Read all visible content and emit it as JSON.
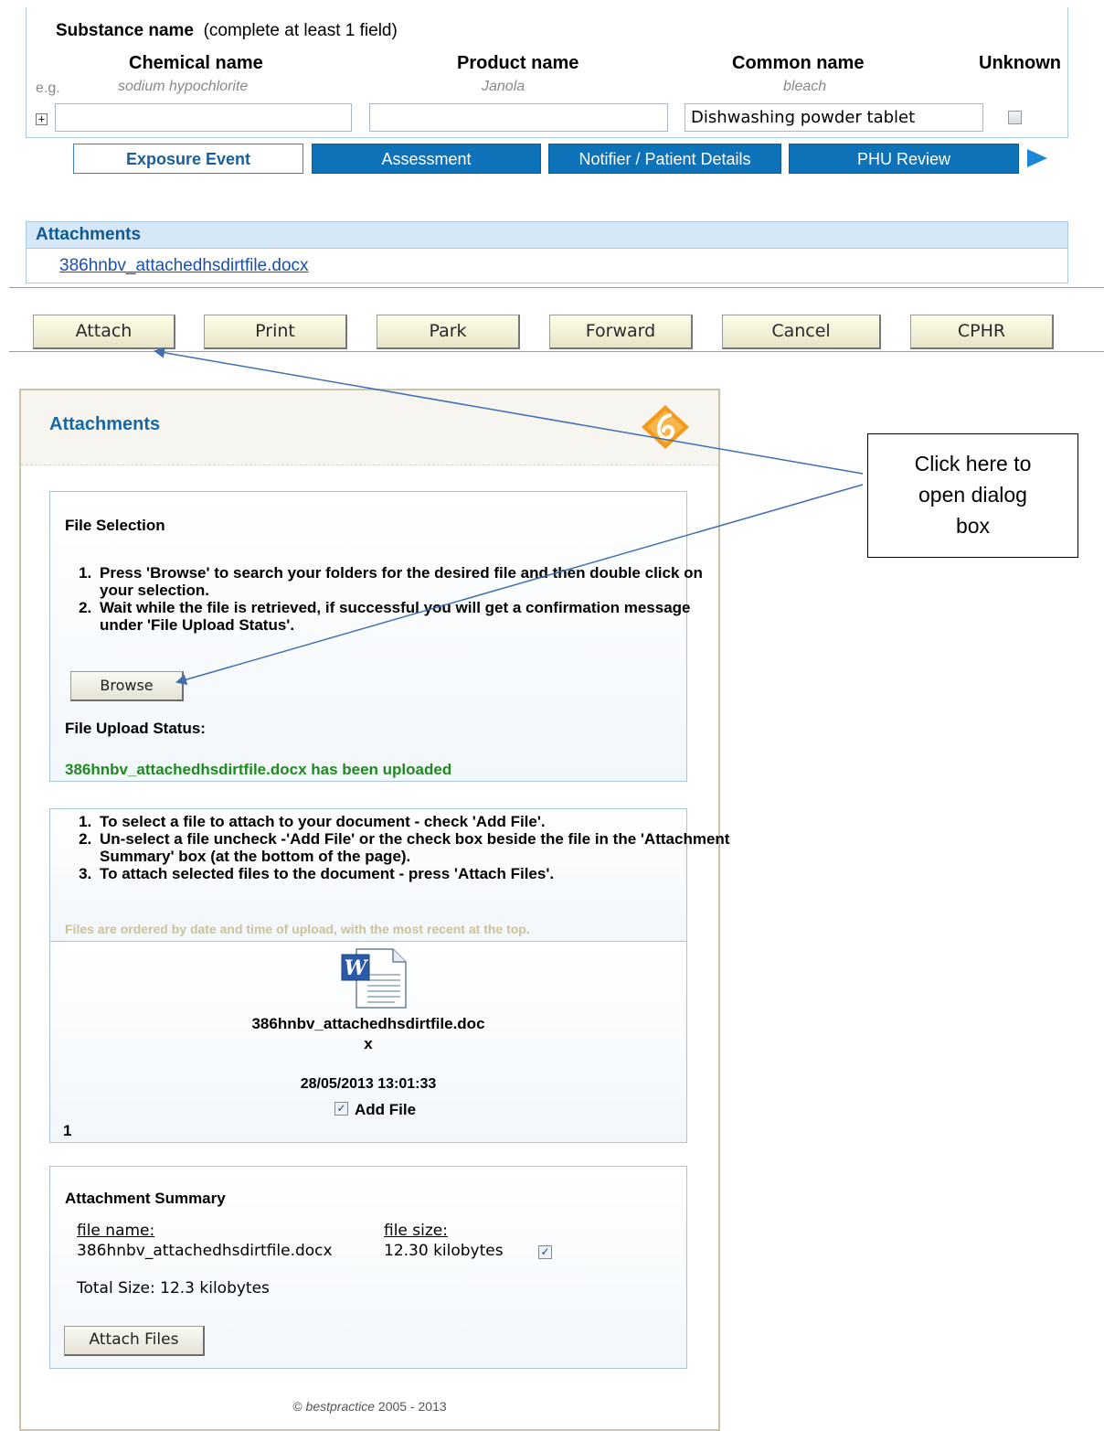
{
  "substance": {
    "title": "Substance name",
    "hint": "(complete at least 1 field)",
    "eg_label": "e.g.",
    "columns": [
      {
        "header": "Chemical name",
        "example": "sodium hypochlorite",
        "value": ""
      },
      {
        "header": "Product name",
        "example": "Janola",
        "value": ""
      },
      {
        "header": "Common name",
        "example": "bleach",
        "value": "Dishwashing powder tablet"
      }
    ],
    "unknown_label": "Unknown",
    "expand_symbol": "+"
  },
  "tabs": [
    {
      "label": "Exposure Event",
      "active": true
    },
    {
      "label": "Assessment",
      "active": false
    },
    {
      "label": "Notifier / Patient Details",
      "active": false
    },
    {
      "label": "PHU Review",
      "active": false
    }
  ],
  "tab_next_icon": "play-right-arrow-icon",
  "attachments_bar": {
    "title": "Attachments",
    "file_link": "386hnbv_attachedhsdirtfile.docx"
  },
  "actions": [
    "Attach",
    "Print",
    "Park",
    "Forward",
    "Cancel",
    "CPHR"
  ],
  "dialog": {
    "title": "Attachments",
    "logo_icon": "bestpractice-logo-icon",
    "file_selection": {
      "title": "File Selection",
      "steps": [
        "Press 'Browse' to search your folders for the desired file and then double click on your selection.",
        "Wait while the file is retrieved, if successful you will get a confirmation message under 'File Upload Status'."
      ],
      "browse_label": "Browse",
      "status_title": "File Upload Status:",
      "status_message": "386hnbv_attachedhsdirtfile.docx has been uploaded"
    },
    "instructions": {
      "steps": [
        "To select a file to attach to your document - check 'Add File'.",
        "Un-select a file uncheck -'Add File' or the check box beside the file in the 'Attachment Summary' box (at the bottom of the page).",
        "To attach selected files to the document - press 'Attach Files'."
      ],
      "note": "Files are ordered by date and time of upload, with the most recent at the top."
    },
    "file_card": {
      "icon": "word-document-icon",
      "name_line1": "386hnbv_attachedhsdirtfile.doc",
      "name_line2": "x",
      "timestamp": "28/05/2013 13:01:33",
      "add_label": "Add File",
      "add_checked": true,
      "index": "1"
    },
    "summary": {
      "title": "Attachment Summary",
      "name_header": "file name:",
      "size_header": "file size:",
      "file_name": "386hnbv_attachedhsdirtfile.docx",
      "file_size": "12.30 kilobytes",
      "checked": true,
      "total": "Total Size: 12.3 kilobytes",
      "attach_label": "Attach Files"
    },
    "footer": {
      "copyright": "©",
      "brand": "bestpractice",
      "years": "2005 - 2013"
    }
  },
  "callout": {
    "lines": [
      "Click here to",
      "open dialog",
      "box"
    ]
  },
  "colors": {
    "tab_blue": "#0e72b8",
    "status_green": "#1f8a1f",
    "header_blue": "#0f5a93",
    "logo_orange": "#f39a1e"
  }
}
